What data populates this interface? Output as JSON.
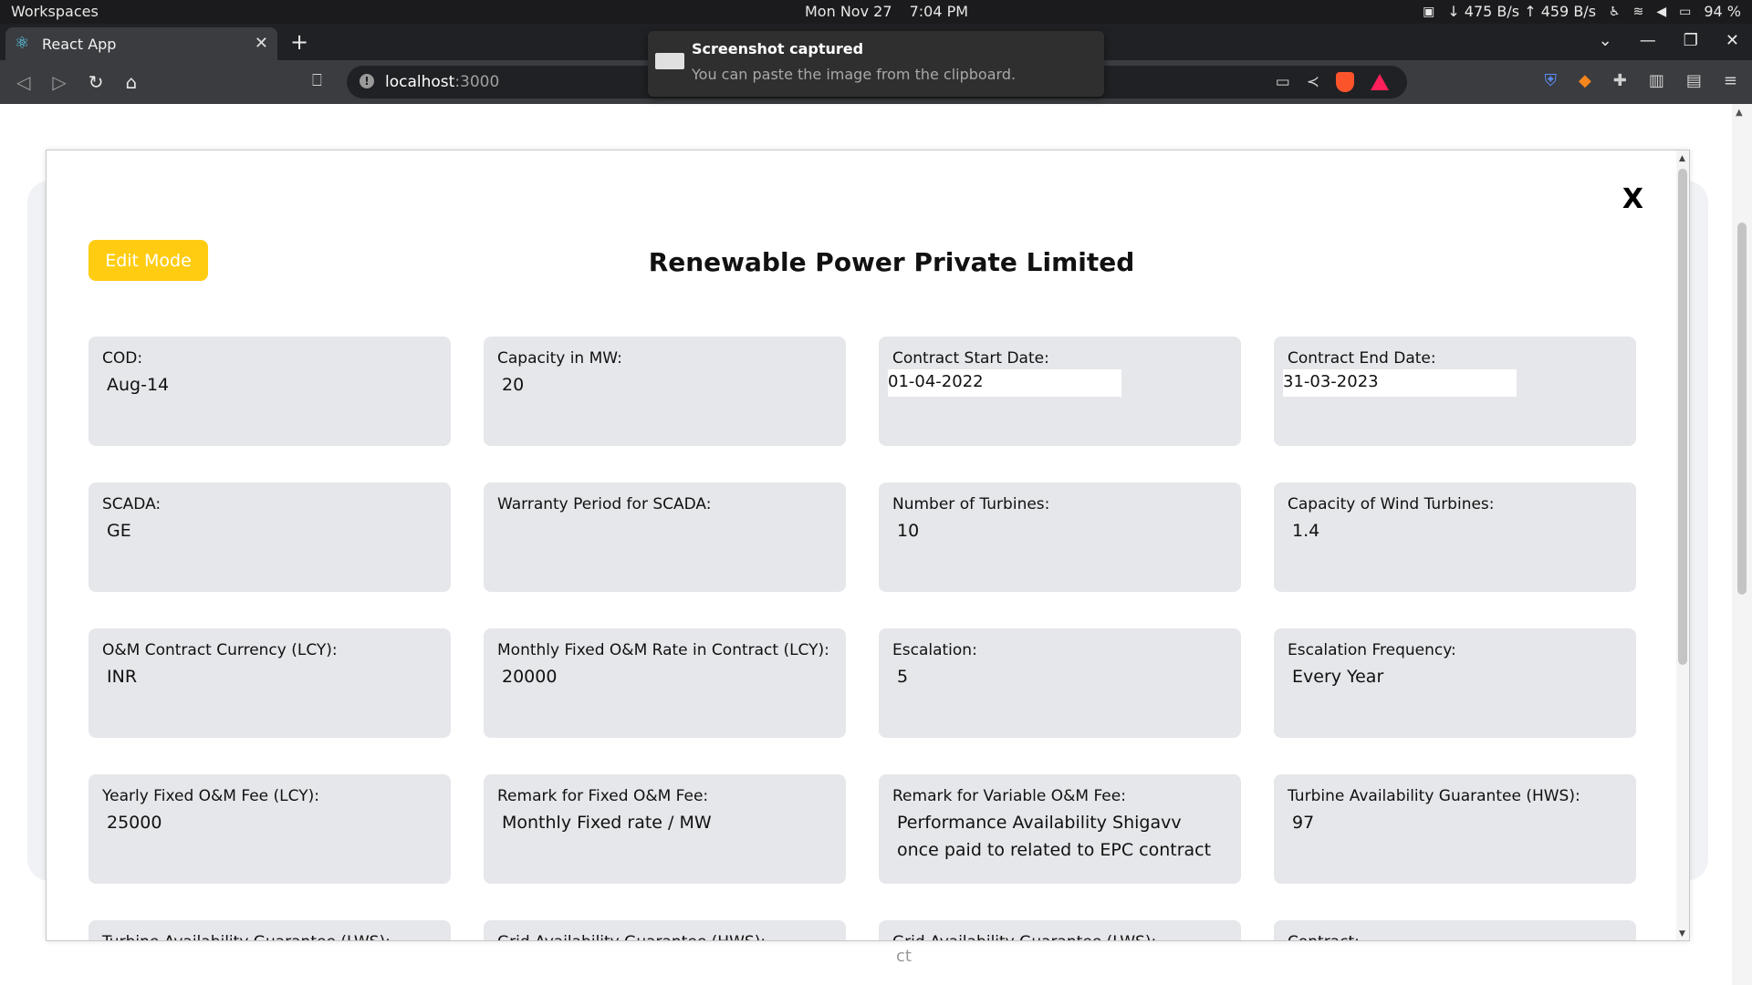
{
  "os": {
    "workspaces": "Workspaces",
    "date": "Mon Nov 27",
    "time": "7:04 PM",
    "network": "↓ 475 B/s ↑ 459 B/s",
    "battery": "94 %"
  },
  "browser": {
    "tab_title": "React App",
    "url_host": "localhost",
    "url_port": ":3000"
  },
  "toast": {
    "title": "Screenshot captured",
    "message": "You can paste the image from the clipboard."
  },
  "modal": {
    "close_label": "X",
    "edit_label": "Edit Mode",
    "title": "Renewable Power Private Limited",
    "fields": [
      {
        "label": "COD:",
        "value": "Aug-14"
      },
      {
        "label": "Capacity in MW:",
        "value": "20"
      },
      {
        "label": "Contract Start Date:",
        "value": "01-04-2022"
      },
      {
        "label": "Contract End Date:",
        "value": "31-03-2023"
      },
      {
        "label": "SCADA:",
        "value": "GE"
      },
      {
        "label": "Warranty Period for SCADA:",
        "value": ""
      },
      {
        "label": "Number of Turbines:",
        "value": "10"
      },
      {
        "label": "Capacity of Wind Turbines:",
        "value": "1.4"
      },
      {
        "label": "O&M Contract Currency (LCY):",
        "value": "INR"
      },
      {
        "label": "Monthly Fixed O&M Rate in Contract (LCY):",
        "value": "20000"
      },
      {
        "label": "Escalation:",
        "value": "5"
      },
      {
        "label": "Escalation Frequency:",
        "value": "Every Year"
      },
      {
        "label": "Yearly Fixed O&M Fee (LCY):",
        "value": "25000"
      },
      {
        "label": "Remark for Fixed O&M Fee:",
        "value": "Monthly Fixed rate / MW"
      },
      {
        "label": "Remark for Variable O&M Fee:",
        "value": "Performance Availability Shigavv once paid to related to EPC contract"
      },
      {
        "label": "Turbine Availability Guarantee (HWS):",
        "value": "97"
      },
      {
        "label": "Turbine Availability Guarantee (LWS):",
        "value": ""
      },
      {
        "label": "Grid Availability Guarantee (HWS):",
        "value": ""
      },
      {
        "label": "Grid Availability Guarantee (LWS):",
        "value": ""
      },
      {
        "label": "Contract:",
        "value": ""
      }
    ]
  },
  "background": {
    "ghost_text": "ct"
  }
}
